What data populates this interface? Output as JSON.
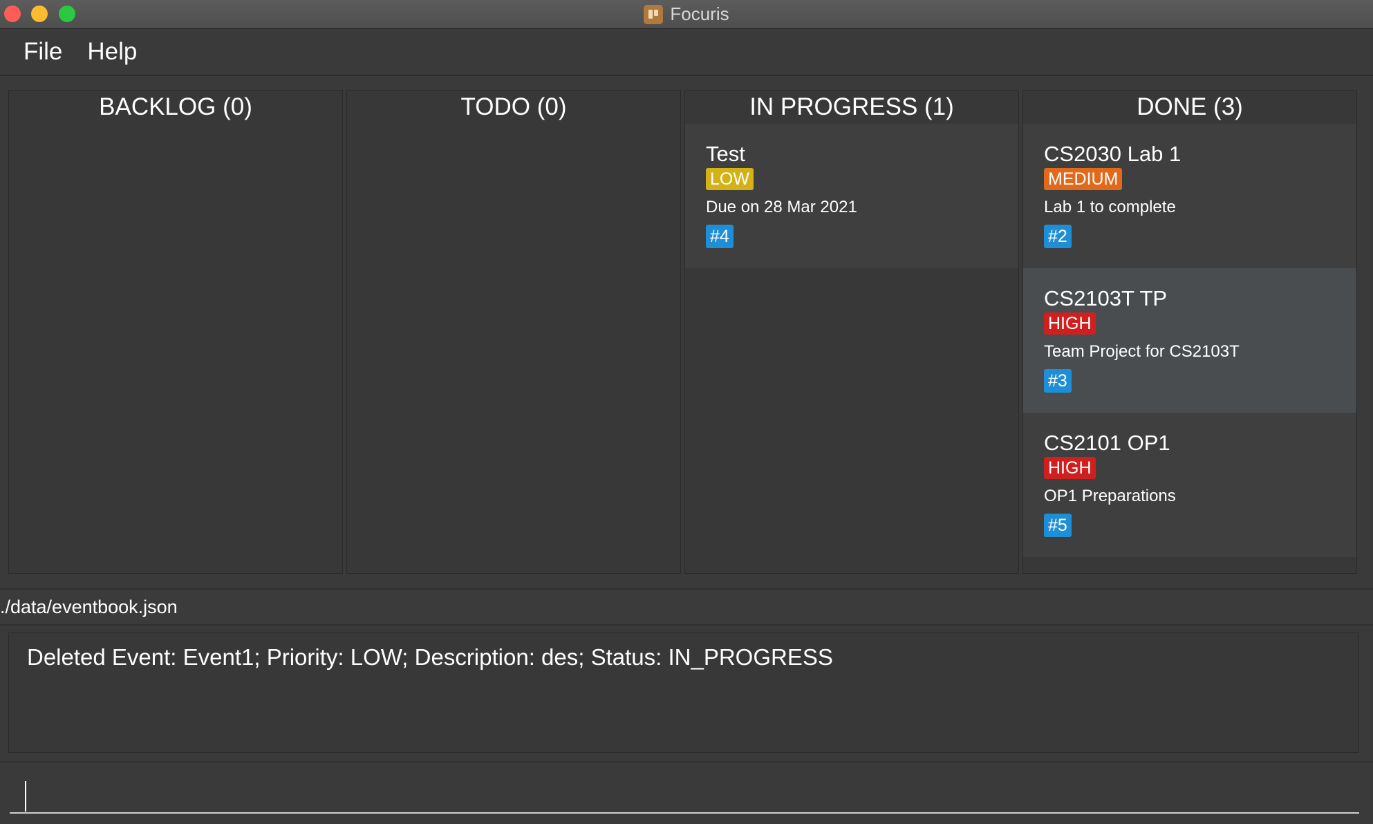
{
  "window": {
    "title": "Focuris",
    "controls": [
      "close",
      "minimize",
      "maximize"
    ]
  },
  "menu": [
    {
      "label": "File"
    },
    {
      "label": "Help"
    }
  ],
  "columns": [
    {
      "header": "BACKLOG (0)",
      "cards": []
    },
    {
      "header": "TODO (0)",
      "cards": []
    },
    {
      "header": "IN PROGRESS (1)",
      "cards": [
        {
          "name": "Test",
          "priority": "LOW",
          "description": "Due on 28 Mar 2021",
          "id": "#4",
          "selected": false
        }
      ]
    },
    {
      "header": "DONE (3)",
      "cards": [
        {
          "name": "CS2030 Lab 1",
          "priority": "MEDIUM",
          "description": "Lab 1 to complete",
          "id": "#2",
          "selected": false
        },
        {
          "name": "CS2103T TP",
          "priority": "HIGH",
          "description": "Team Project for CS2103T",
          "id": "#3",
          "selected": true
        },
        {
          "name": "CS2101 OP1",
          "priority": "HIGH",
          "description": "OP1 Preparations",
          "id": "#5",
          "selected": false
        }
      ]
    }
  ],
  "priority_colors": {
    "LOW": "#d4b217",
    "MEDIUM": "#e0691c",
    "HIGH": "#cf1f1f"
  },
  "status_bar": {
    "file_path": "./data/eventbook.json"
  },
  "result_display": {
    "text": "Deleted Event: Event1; Priority: LOW; Description: des; Status: IN_PROGRESS"
  },
  "command_box": {
    "value": "",
    "placeholder": ""
  }
}
